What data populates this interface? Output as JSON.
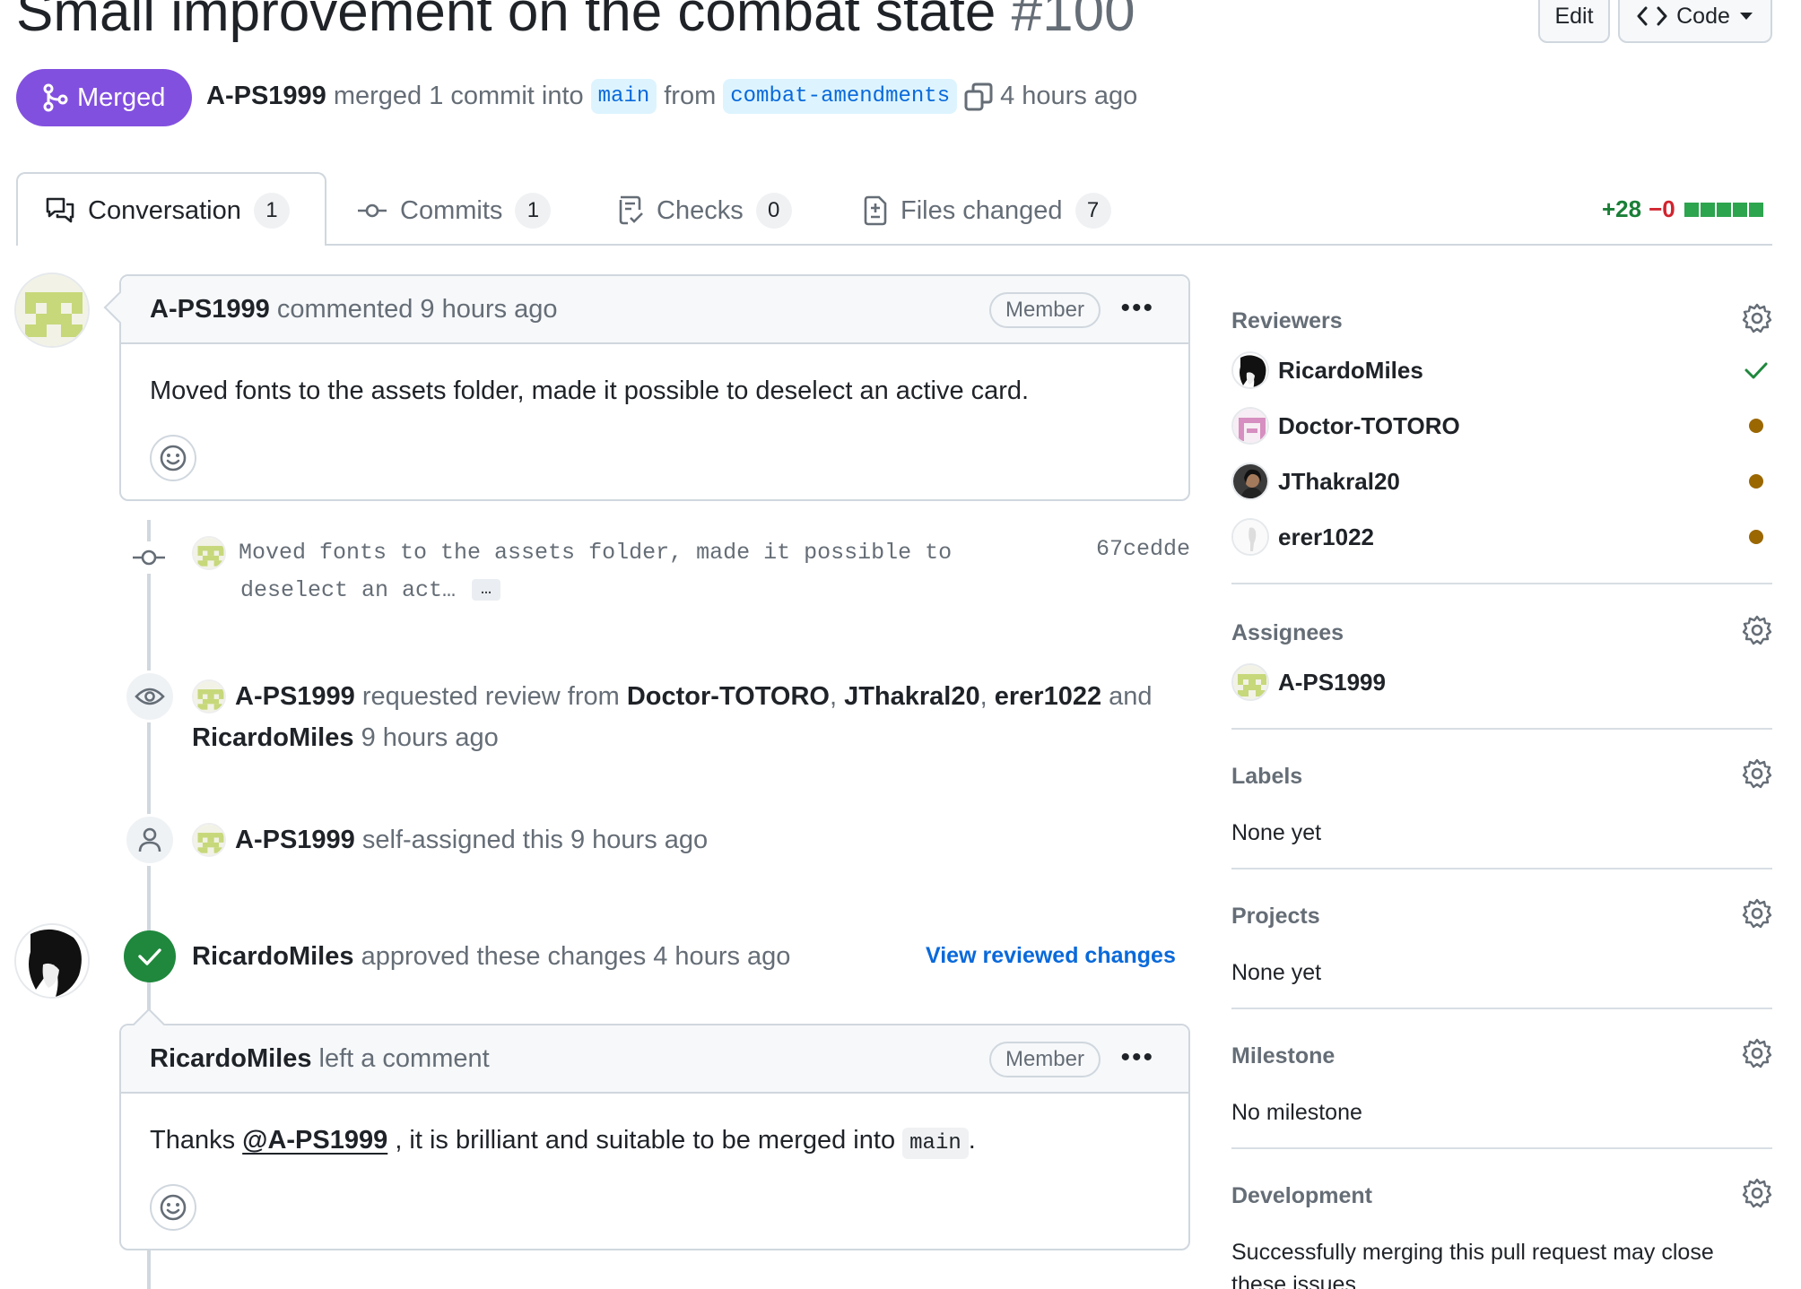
{
  "header": {
    "title": "Small improvement on the combat state",
    "number": "#100",
    "edit_label": "Edit",
    "code_label": "Code",
    "status": "Merged",
    "author": "A-PS1999",
    "merged_text": "merged 1 commit into",
    "base_branch": "main",
    "from_text": "from",
    "head_branch": "combat-amendments",
    "time": "4 hours ago"
  },
  "tabs": [
    {
      "label": "Conversation",
      "count": "1"
    },
    {
      "label": "Commits",
      "count": "1"
    },
    {
      "label": "Checks",
      "count": "0"
    },
    {
      "label": "Files changed",
      "count": "7"
    }
  ],
  "diffstat": {
    "additions": "+28",
    "deletions": "−0"
  },
  "timeline": {
    "comment1": {
      "author": "A-PS1999",
      "action": "commented 9 hours ago",
      "role": "Member",
      "body": "Moved fonts to the assets folder, made it possible to deselect an active card."
    },
    "commit": {
      "message_line1": "Moved fonts to the assets folder, made it possible to",
      "message_line2": "deselect an act…",
      "sha": "67cedde"
    },
    "review_request": {
      "actor": "A-PS1999",
      "text": "requested review from",
      "r1": "Doctor-TOTORO",
      "r2": "JThakral20",
      "r3": "erer1022",
      "and": "and",
      "r4": "RicardoMiles",
      "time": "9 hours ago"
    },
    "self_assign": {
      "actor": "A-PS1999",
      "text": "self-assigned this 9 hours ago"
    },
    "approval": {
      "actor": "RicardoMiles",
      "text": "approved these changes 4 hours ago",
      "link": "View reviewed changes"
    },
    "comment2": {
      "author": "RicardoMiles",
      "action": "left a comment",
      "role": "Member",
      "body_before": "Thanks",
      "mention": "@A-PS1999",
      "body_middle": ", it is brilliant and suitable to be merged into",
      "code": "main",
      "body_after": "."
    }
  },
  "sidebar": {
    "reviewers": {
      "title": "Reviewers",
      "items": [
        {
          "name": "RicardoMiles",
          "state": "approved"
        },
        {
          "name": "Doctor-TOTORO",
          "state": "pending"
        },
        {
          "name": "JThakral20",
          "state": "pending"
        },
        {
          "name": "erer1022",
          "state": "pending"
        }
      ]
    },
    "assignees": {
      "title": "Assignees",
      "name": "A-PS1999"
    },
    "labels": {
      "title": "Labels",
      "value": "None yet"
    },
    "projects": {
      "title": "Projects",
      "value": "None yet"
    },
    "milestone": {
      "title": "Milestone",
      "value": "No milestone"
    },
    "development": {
      "title": "Development",
      "value": "Successfully merging this pull request may close these issues."
    }
  },
  "colors": {
    "merged": "#8250df",
    "link": "#0969da",
    "approved": "#1f883d",
    "pending": "#9a6700",
    "additions": "#1a7f37",
    "deletions": "#d1242f"
  },
  "icons": [
    "merge-icon",
    "code-icon",
    "copy-icon",
    "conversation-icon",
    "commit-icon",
    "checks-icon",
    "file-diff-icon",
    "eye-icon",
    "person-icon",
    "check-icon",
    "smiley-icon",
    "gear-icon",
    "kebab-icon"
  ]
}
